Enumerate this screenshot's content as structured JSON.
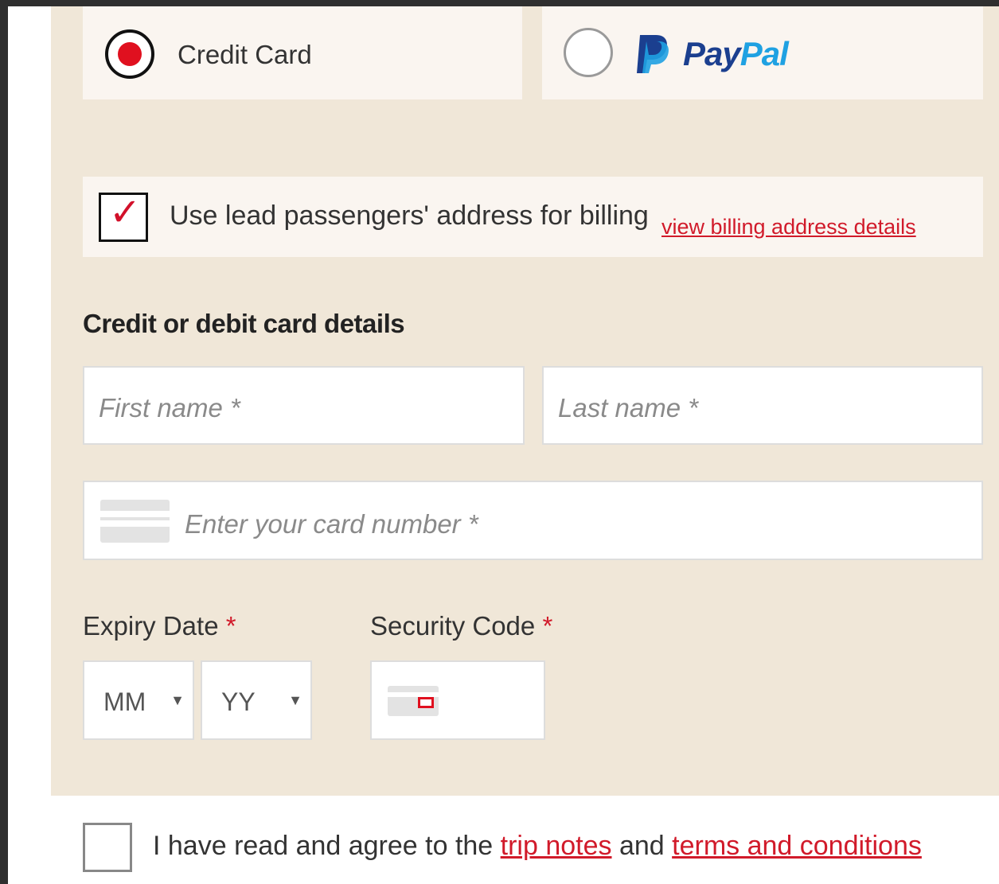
{
  "payment_methods": {
    "credit_card_label": "Credit Card",
    "paypal_label_pay": "Pay",
    "paypal_label_pal": "Pal",
    "selected": "credit_card"
  },
  "billing": {
    "checkbox_checked": true,
    "label": "Use lead passengers' address for billing",
    "link": "view billing address details"
  },
  "card_details": {
    "title": "Credit or debit card details",
    "first_name_placeholder": "First name *",
    "last_name_placeholder": "Last name *",
    "card_number_placeholder": "Enter your card number *",
    "expiry_label": "Expiry Date",
    "security_label": "Security Code",
    "required_mark": "*",
    "month_value": "MM",
    "year_value": "YY"
  },
  "terms": {
    "text_before": "I have read and agree to the ",
    "trip_notes_link": "trip notes",
    "text_middle": " and ",
    "terms_link": "terms and conditions",
    "checked": false
  },
  "colors": {
    "accent_red": "#d11a2a",
    "panel_bg": "#f0e7d8",
    "paypal_dark": "#1b3f8f",
    "paypal_light": "#1fa1e2"
  }
}
